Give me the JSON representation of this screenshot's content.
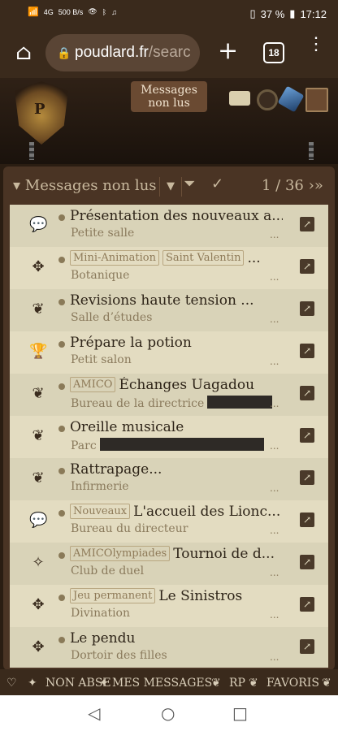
{
  "status_bar": {
    "network": "4G",
    "speed": "500 B/s",
    "battery": "37 %",
    "time": "17:12"
  },
  "browser": {
    "url_host": "poudlard.fr",
    "url_rest": "/searc",
    "tab_count": "18"
  },
  "header": {
    "messages_label": "Messages non lus"
  },
  "toolbar": {
    "title": "Messages non lus",
    "pagination": "1 / 36"
  },
  "rows": [
    {
      "icon": "speech-bubble-icon",
      "tags": [],
      "title": "Présentation des nouveaux a...",
      "subtitle": "Petite salle",
      "redacted": false,
      "more": "..."
    },
    {
      "icon": "puzzle-icon",
      "tags": [
        "Mini-Animation",
        "Saint Valentin"
      ],
      "title": "...",
      "subtitle": "Botanique",
      "redacted": false,
      "more": "..."
    },
    {
      "icon": "leaf-icon",
      "tags": [],
      "title": "Revisions haute tension ...",
      "subtitle": "Salle d’études",
      "redacted": false,
      "more": "..."
    },
    {
      "icon": "trophy-icon",
      "tags": [],
      "title": "Prépare la potion",
      "subtitle": "Petit salon",
      "redacted": false,
      "more": "..."
    },
    {
      "icon": "leaf-icon",
      "tags": [
        "AMICO"
      ],
      "title": "Échanges Uagadou",
      "subtitle": "Bureau de la directrice",
      "redacted": true,
      "more": "..."
    },
    {
      "icon": "leaf-icon",
      "tags": [],
      "title": "Oreille musicale",
      "subtitle": "Parc",
      "redacted": true,
      "more": "..."
    },
    {
      "icon": "leaf-icon",
      "tags": [],
      "title": "Rattrapage...",
      "subtitle": "Infirmerie",
      "redacted": false,
      "more": "..."
    },
    {
      "icon": "speech-bubble-icon",
      "tags": [
        "Nouveaux"
      ],
      "title": "L'accueil des Lionc...",
      "subtitle": "Bureau du directeur",
      "redacted": false,
      "more": "..."
    },
    {
      "icon": "magic-wand-icon",
      "tags": [
        "AMICOlympiades"
      ],
      "title": "Tournoi de d...",
      "subtitle": "Club de duel",
      "redacted": false,
      "more": "..."
    },
    {
      "icon": "puzzle-icon",
      "tags": [
        "Jeu permanent"
      ],
      "title": "Le Sinistros",
      "subtitle": "Divination",
      "redacted": false,
      "more": "..."
    },
    {
      "icon": "puzzle-icon",
      "tags": [],
      "title": "Le pendu",
      "subtitle": "Dortoir des filles",
      "redacted": false,
      "more": "..."
    }
  ],
  "bottom_nav": {
    "item1": "NON ABSE",
    "item2": "MES MESSAGES",
    "item3": "RP",
    "item4": "FAVORIS"
  }
}
